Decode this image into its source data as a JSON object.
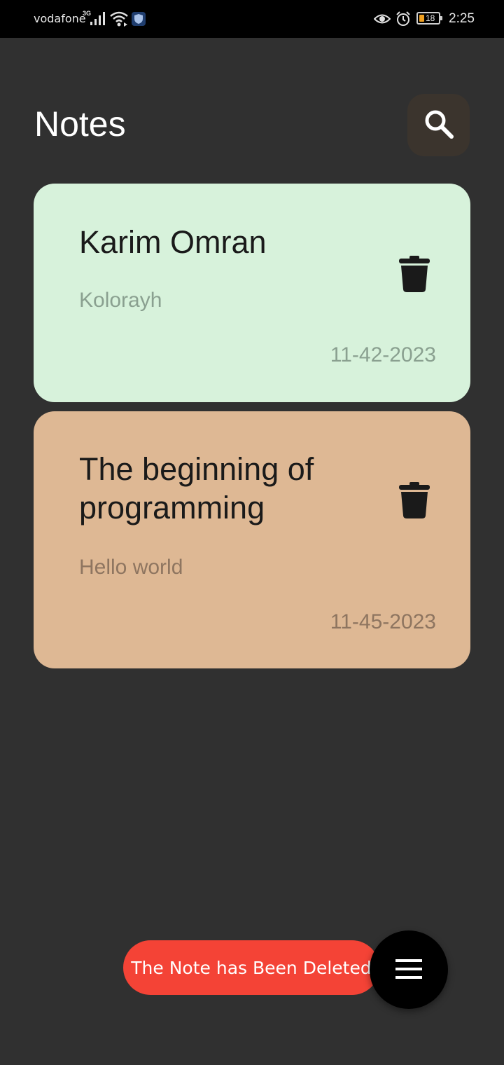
{
  "status_bar": {
    "carrier": "vodafone",
    "network": "3G",
    "battery": "18",
    "time": "2:25"
  },
  "header": {
    "title": "Notes",
    "search_icon": "search-icon"
  },
  "notes": [
    {
      "title": "Karim Omran",
      "body": "Kolorayh",
      "date": "11-42-2023",
      "color": "#d7f2db"
    },
    {
      "title": "The beginning of programming",
      "body": "Hello world",
      "date": "11-45-2023",
      "color": "#deb894"
    }
  ],
  "snackbar": {
    "message": "The Note has Been Deleted",
    "color": "#f44336"
  },
  "fab": {
    "icon": "menu-icon"
  },
  "colors": {
    "background": "#303030",
    "search_button": "#3b342d"
  }
}
